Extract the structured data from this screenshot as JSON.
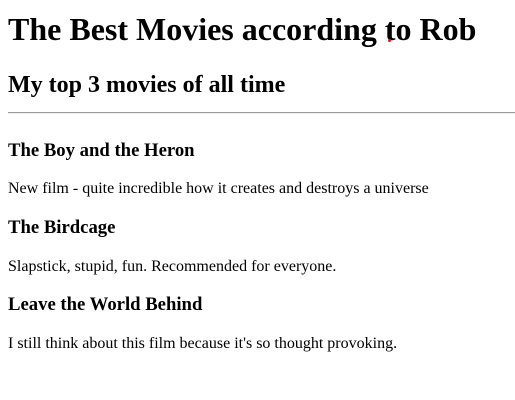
{
  "page": {
    "title": "The Best Movies according to Rob",
    "subtitle": "My top 3 movies of all time"
  },
  "movies": [
    {
      "title": "The Boy and the Heron",
      "description": "New film - quite incredible how it creates and destroys a universe"
    },
    {
      "title": "The Birdcage",
      "description": "Slapstick, stupid, fun. Recommended for everyone."
    },
    {
      "title": "Leave the World Behind",
      "description": "I still think about this film because it's so thought provoking."
    }
  ],
  "colors": {
    "text": "#000000",
    "rule": "#9a9a9a",
    "cursor_dot": "#d81b1b"
  }
}
